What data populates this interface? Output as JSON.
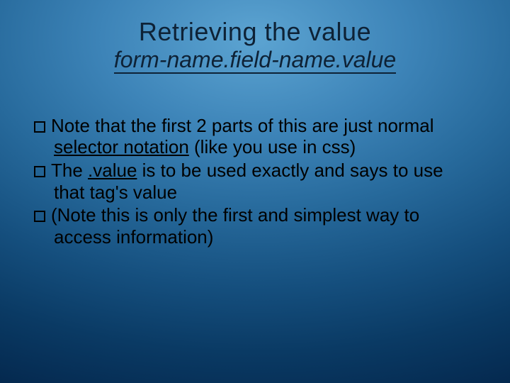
{
  "title": "Retrieving the value",
  "subtitle": "form-name.field-name.value",
  "bullets": {
    "b0a": "Note that the first 2 parts of this are just normal ",
    "b0u": "selector notation",
    "b0b": " (like you use in css)",
    "b1a": "The ",
    "b1u": ".value",
    "b1b": "  is to be used exactly and says to use that tag's value",
    "b2": "(Note this is only the first and simplest way to access information)"
  }
}
